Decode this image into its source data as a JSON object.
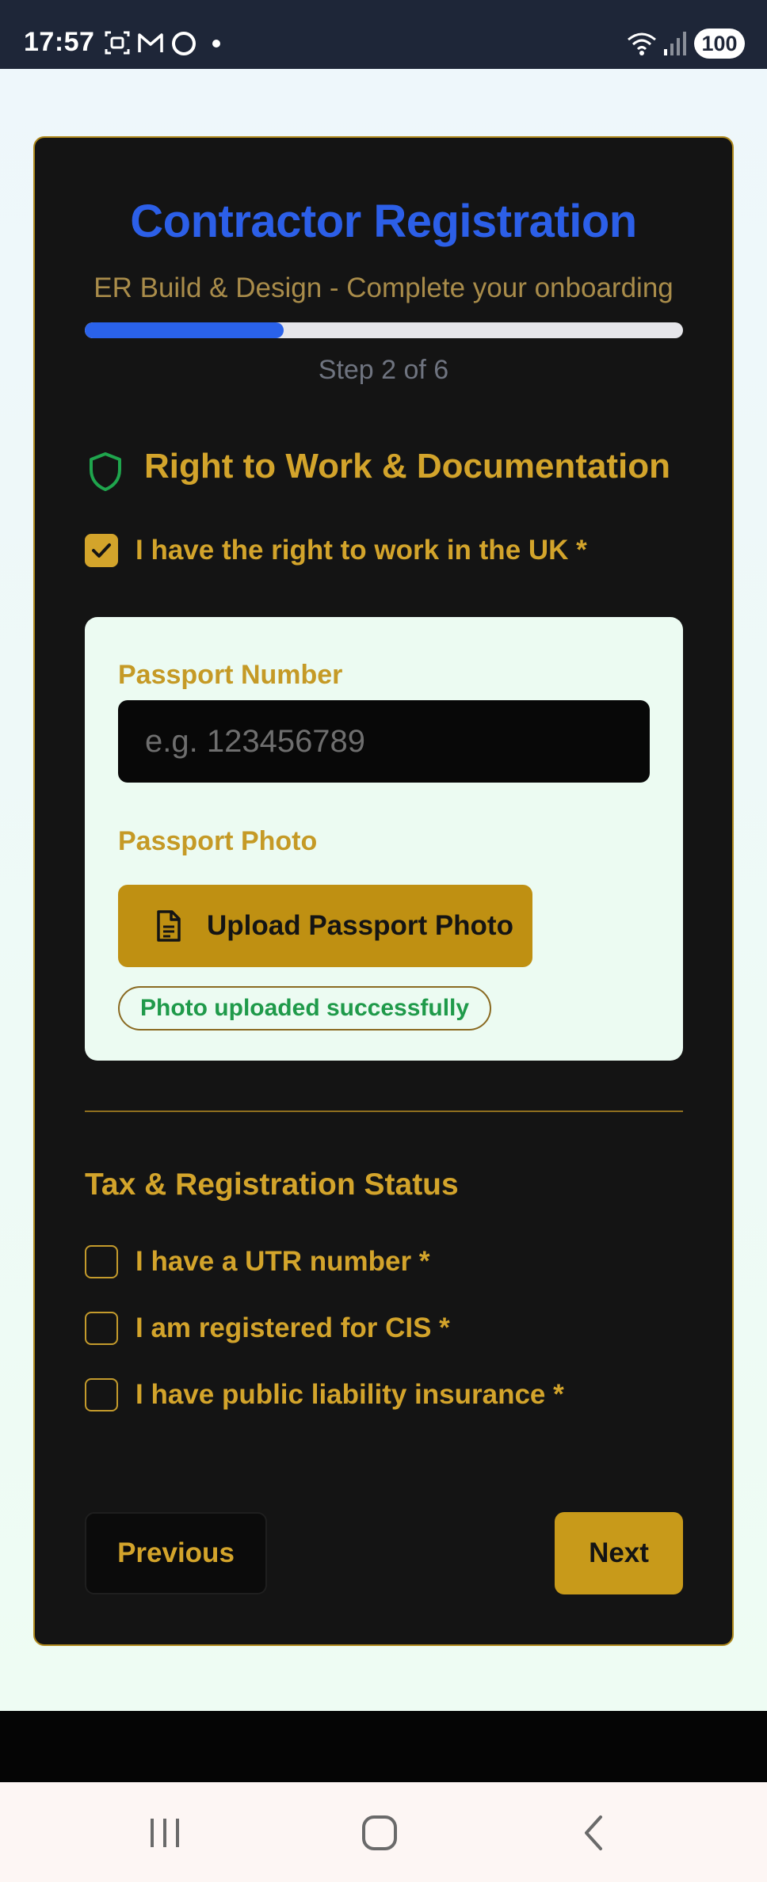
{
  "status_bar": {
    "time": "17:57",
    "battery": "100",
    "icons": [
      "screenshot-icon",
      "gmail-icon",
      "circle-app-icon",
      "notification-dot",
      "wifi-icon",
      "signal-icon",
      "battery-icon"
    ]
  },
  "form": {
    "title": "Contractor Registration",
    "subtitle": "ER Build & Design - Complete your onboarding",
    "progress_fraction": 0.333,
    "step_text": "Step 2 of 6",
    "section_title": "Right to Work & Documentation",
    "right_to_work": {
      "label": "I have the right to work in the UK *",
      "checked": true
    },
    "passport": {
      "number_label": "Passport Number",
      "number_placeholder": "e.g. 123456789",
      "number_value": "",
      "photo_label": "Passport Photo",
      "upload_label": "Upload Passport Photo",
      "status": "Photo uploaded successfully"
    },
    "tax_heading": "Tax & Registration Status",
    "tax_checks": [
      {
        "label": "I have a UTR number *",
        "checked": false
      },
      {
        "label": "I am registered for CIS *",
        "checked": false
      },
      {
        "label": "I have public liability insurance *",
        "checked": false
      }
    ],
    "prev_label": "Previous",
    "next_label": "Next"
  },
  "colors": {
    "accent_gold": "#d3a42b",
    "title_blue": "#2c5fe8",
    "success_green": "#1f9a4a",
    "card_bg": "#141414"
  }
}
